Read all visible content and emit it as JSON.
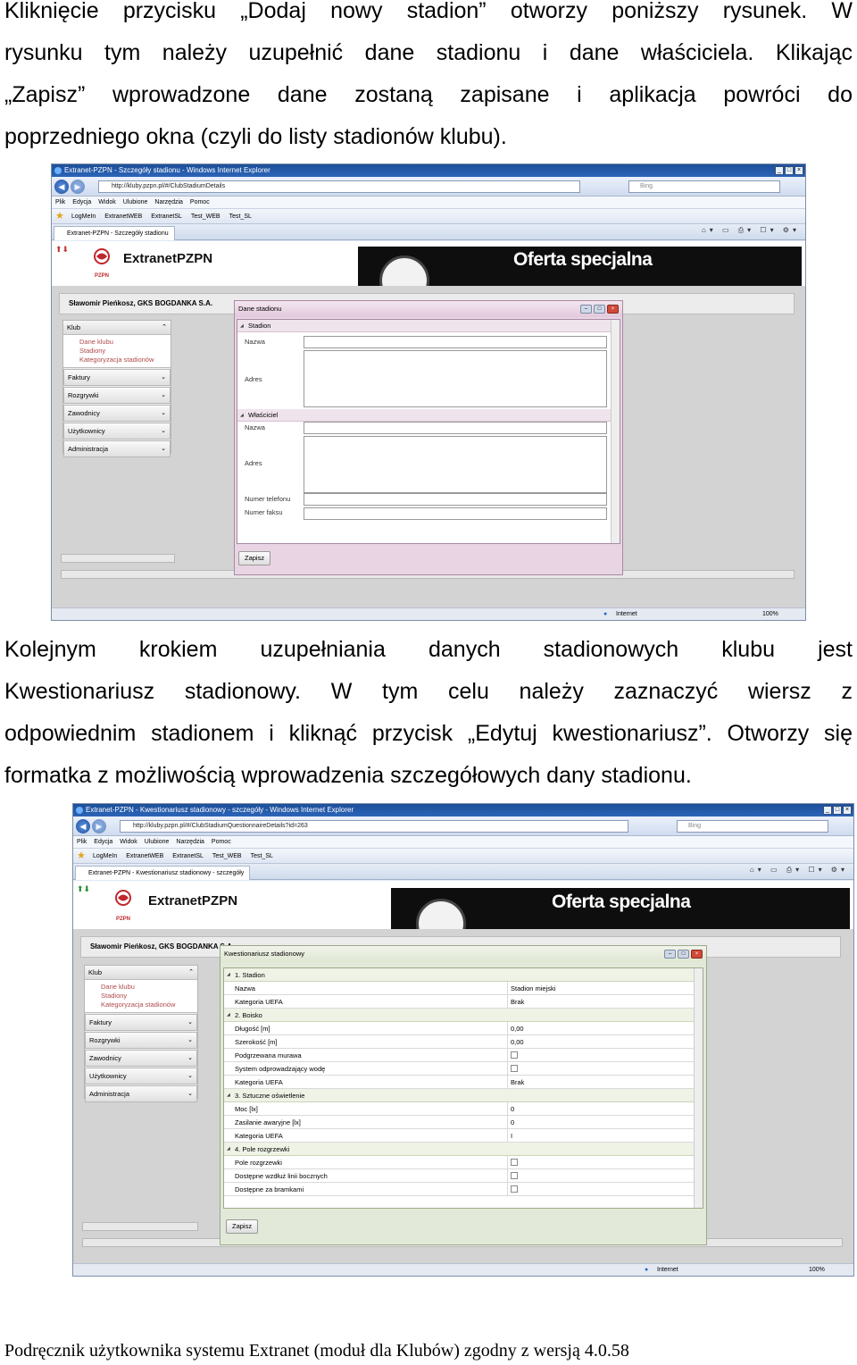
{
  "intro": {
    "lines": [
      "Kliknięcie przycisku „Dodaj nowy stadion” otworzy poniższy rysunek. W",
      "rysunku tym należy uzupełnić dane stadionu i dane właściciela. Klikając",
      "„Zapisz” wprowadzone dane zostaną zapisane i aplikacja powróci do",
      "poprzedniego okna (czyli do listy stadionów klubu)."
    ]
  },
  "middle": {
    "lines": [
      "Kolejnym krokiem uzupełniania danych stadionowych klubu jest",
      "Kwestionariusz stadionowy. W tym celu należy zaznaczyć wiersz z",
      "odpowiednim stadionem i kliknąć przycisk „Edytuj kwestionariusz”. Otworzy się",
      "formatka z możliwością wprowadzenia szczegółowych dany stadionu."
    ]
  },
  "footer": "Podręcznik użytkownika systemu Extranet (moduł dla Klubów) zgodny z wersją 4.0.58",
  "browser": {
    "menu": [
      "Plik",
      "Edycja",
      "Widok",
      "Ulubione",
      "Narzędzia",
      "Pomoc"
    ],
    "favorites": [
      "LogMeIn",
      "ExtranetWEB",
      "ExtranetSL",
      "Test_WEB",
      "Test_SL"
    ],
    "search_placeholder": "Bing",
    "status_zone": "Internet",
    "zoom": "100%"
  },
  "app": {
    "logo": "ExtranetPZPN",
    "logo_sub": "PZPN",
    "offer": "Oferta specjalna",
    "user": "Sławomir Pieńkosz, GKS BOGDANKA S.A.",
    "sidebar": {
      "head": "Klub",
      "subitems": [
        "Dane klubu",
        "Stadiony",
        "Kategoryzacja stadionów"
      ],
      "items": [
        "Faktury",
        "Rozgrywki",
        "Zawodnicy",
        "Użytkownicy",
        "Administracja"
      ]
    },
    "save_label": "Zapisz"
  },
  "shot1": {
    "title": "Extranet-PZPN - Szczegóły stadionu - Windows Internet Explorer",
    "url": "http://kluby.pzpn.pl/#/ClubStadiumDetails",
    "tab": "Extranet-PZPN - Szczegóły stadionu",
    "dialog_title": "Dane stadionu",
    "section_stadion": "Stadion",
    "section_owner": "Właściciel",
    "fields": {
      "nazwa": "Nazwa",
      "adres": "Adres",
      "telefon": "Numer telefonu",
      "faks": "Numer faksu"
    }
  },
  "shot2": {
    "title": "Extranet-PZPN - Kwestionariusz stadionowy - szczegóły - Windows Internet Explorer",
    "url": "http://kluby.pzpn.pl/#/ClubStadiumQuestionnaireDetails?id=263",
    "tab": "Extranet-PZPN - Kwestionariusz stadionowy - szczegóły",
    "dialog_title": "Kwestionariusz stadionowy",
    "sections": [
      {
        "title": "1. Stadion",
        "rows": [
          {
            "k": "Nazwa",
            "v": "Stadion miejski"
          },
          {
            "k": "Kategoria UEFA",
            "v": "Brak"
          }
        ]
      },
      {
        "title": "2. Boisko",
        "rows": [
          {
            "k": "Długość [m]",
            "v": "0,00"
          },
          {
            "k": "Szerokość [m]",
            "v": "0,00"
          },
          {
            "k": "Podgrzewana murawa",
            "v": "",
            "checkbox": true
          },
          {
            "k": "System odprowadzający wodę",
            "v": "",
            "checkbox": true
          },
          {
            "k": "Kategoria UEFA",
            "v": "Brak"
          }
        ]
      },
      {
        "title": "3. Sztuczne oświetlenie",
        "rows": [
          {
            "k": "Moc [lx]",
            "v": "0"
          },
          {
            "k": "Zasilanie awaryjne [lx]",
            "v": "0"
          },
          {
            "k": "Kategoria UEFA",
            "v": "I"
          }
        ]
      },
      {
        "title": "4. Pole rozgrzewki",
        "rows": [
          {
            "k": "Pole rozgrzewki",
            "v": "",
            "checkbox": true
          },
          {
            "k": "Dostępne wzdłuż linii bocznych",
            "v": "",
            "checkbox": true
          },
          {
            "k": "Dostępne za bramkami",
            "v": "",
            "checkbox": true
          }
        ]
      }
    ]
  }
}
